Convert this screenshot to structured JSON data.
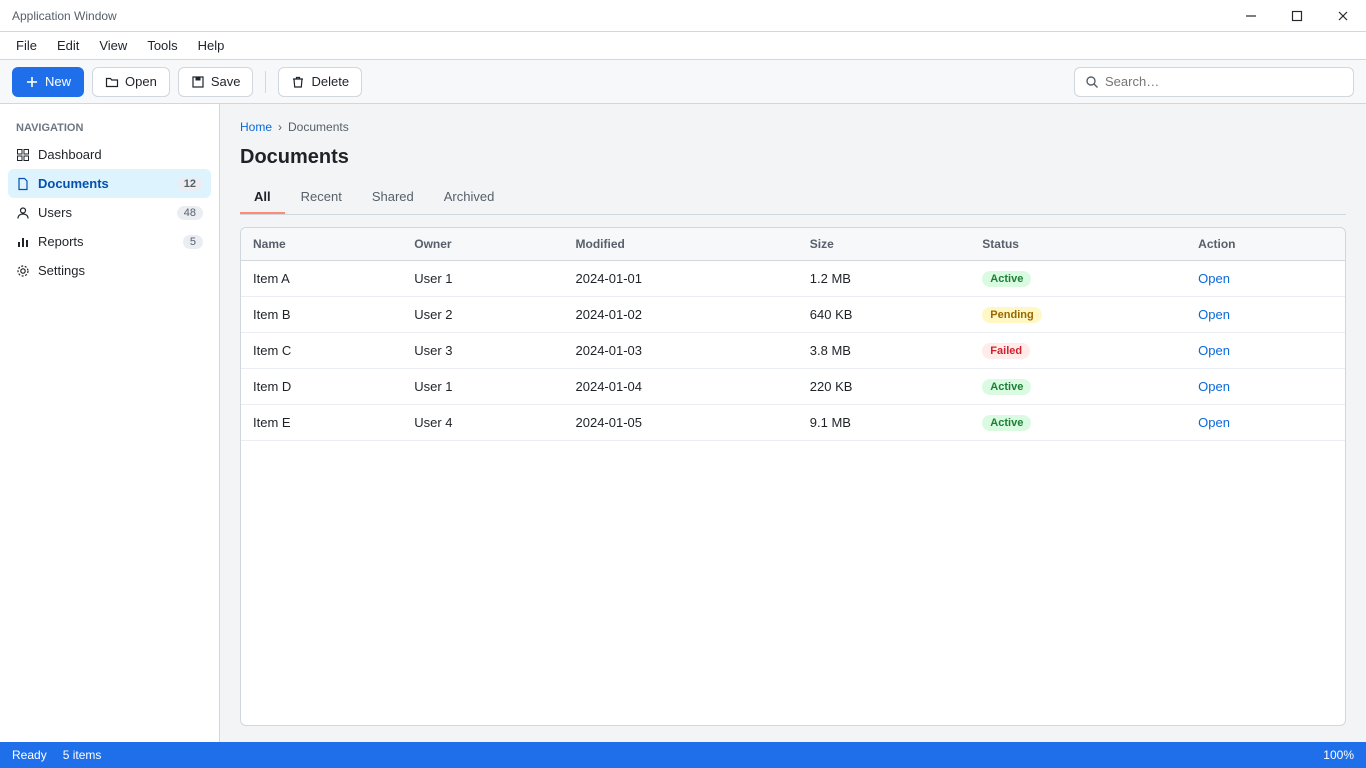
{
  "window": {
    "title": "Application Window"
  },
  "menu": [
    "File",
    "Edit",
    "View",
    "Tools",
    "Help"
  ],
  "toolbar": {
    "new_label": "New",
    "open_label": "Open",
    "save_label": "Save",
    "delete_label": "Delete",
    "search_placeholder": "Search…"
  },
  "sidebar": {
    "heading": "Navigation",
    "items": [
      {
        "label": "Dashboard",
        "count": ""
      },
      {
        "label": "Documents",
        "count": "12"
      },
      {
        "label": "Users",
        "count": "48"
      },
      {
        "label": "Reports",
        "count": "5"
      },
      {
        "label": "Settings",
        "count": ""
      }
    ]
  },
  "main": {
    "breadcrumb": [
      "Home",
      "Documents"
    ],
    "title": "Documents",
    "tabs": [
      "All",
      "Recent",
      "Shared",
      "Archived"
    ]
  },
  "table": {
    "columns": [
      "Name",
      "Owner",
      "Modified",
      "Size",
      "Status",
      "Action"
    ],
    "rows": [
      {
        "name": "Item A",
        "owner": "User 1",
        "modified": "2024-01-01",
        "size": "1.2 MB",
        "status": "Active",
        "status_kind": "ok",
        "action": "Open"
      },
      {
        "name": "Item B",
        "owner": "User 2",
        "modified": "2024-01-02",
        "size": "640 KB",
        "status": "Pending",
        "status_kind": "warn",
        "action": "Open"
      },
      {
        "name": "Item C",
        "owner": "User 3",
        "modified": "2024-01-03",
        "size": "3.8 MB",
        "status": "Failed",
        "status_kind": "err",
        "action": "Open"
      },
      {
        "name": "Item D",
        "owner": "User 1",
        "modified": "2024-01-04",
        "size": "220 KB",
        "status": "Active",
        "status_kind": "ok",
        "action": "Open"
      },
      {
        "name": "Item E",
        "owner": "User 4",
        "modified": "2024-01-05",
        "size": "9.1 MB",
        "status": "Active",
        "status_kind": "ok",
        "action": "Open"
      }
    ]
  },
  "status": {
    "left": "Ready",
    "middle": "5 items",
    "right": "100%"
  }
}
